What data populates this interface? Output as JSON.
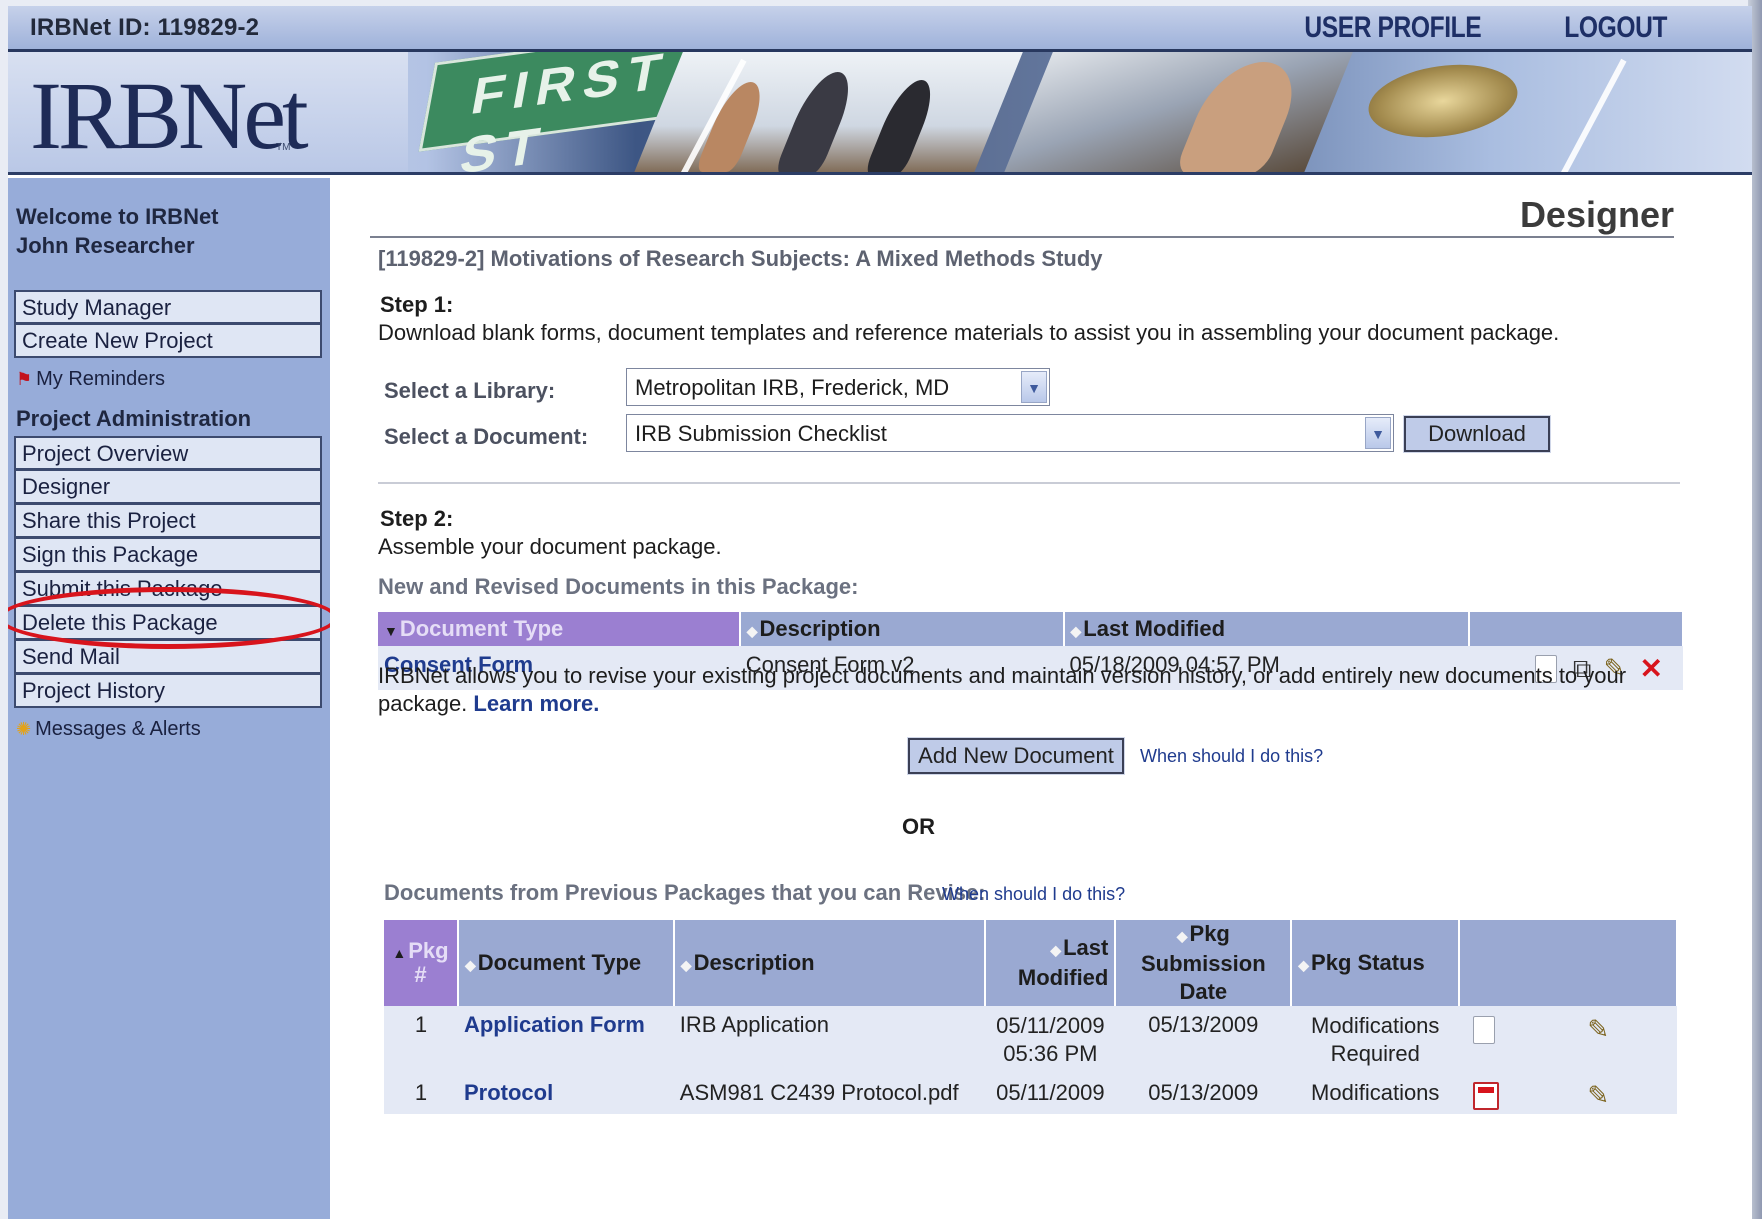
{
  "topbar": {
    "irb_id": "IRBNet ID: 119829-2",
    "user_profile": "USER PROFILE",
    "logout": "LOGOUT"
  },
  "banner": {
    "logo_text": "IRBNet",
    "tm": "TM",
    "street_sign": "FIRST ST"
  },
  "sidebar": {
    "welcome_line1": "Welcome to IRBNet",
    "welcome_line2": "John Researcher",
    "main_items": [
      "Study Manager",
      "Create New Project"
    ],
    "reminders": "My Reminders",
    "section_title": "Project Administration",
    "admin_items": [
      "Project Overview",
      "Designer",
      "Share this Project",
      "Sign this Package",
      "Submit this Package",
      "Delete this Package",
      "Send Mail",
      "Project History"
    ],
    "messages": "Messages & Alerts"
  },
  "main": {
    "page_title": "Designer",
    "project_title": "[119829-2] Motivations of Research Subjects: A Mixed Methods Study",
    "step1_label": "Step 1:",
    "step1_desc": "Download blank forms, document templates and reference materials to assist you in assembling your document package.",
    "library_label": "Select a Library:",
    "library_value": "Metropolitan IRB, Frederick, MD",
    "document_label": "Select a Document:",
    "document_value": "IRB Submission Checklist",
    "download_button": "Download",
    "step2_label": "Step 2:",
    "step2_desc": "Assemble your document package.",
    "new_docs_heading": "New and Revised Documents in this Package:",
    "new_docs_table": {
      "headers": [
        "Document Type",
        "Description",
        "Last Modified"
      ],
      "rows": [
        {
          "type": "Consent Form",
          "description": "Consent Form v2",
          "modified": "05/18/2009 04:57 PM"
        }
      ]
    },
    "info_text": "IRBNet allows you to revise your existing project documents and maintain version history, or add entirely new documents to your package.",
    "learn_more": "Learn more.",
    "add_button": "Add New Document",
    "when_link": "When should I do this?",
    "or_text": "OR",
    "prev_docs_heading": "Documents from Previous Packages that you can Revise:",
    "prev_when_link": "When should I do this?",
    "prev_table": {
      "headers": [
        "Pkg #",
        "Document Type",
        "Description",
        "Last Modified",
        "Pkg Submission Date",
        "Pkg Status"
      ],
      "rows": [
        {
          "pkg": "1",
          "type": "Application Form",
          "description": "IRB Application",
          "modified_date": "05/11/2009",
          "modified_time": "05:36 PM",
          "submitted": "05/13/2009",
          "status_line1": "Modifications",
          "status_line2": "Required",
          "icon": "document-icon"
        },
        {
          "pkg": "1",
          "type": "Protocol",
          "description": "ASM981 C2439 Protocol.pdf",
          "modified_date": "05/11/2009",
          "modified_time": "",
          "submitted": "05/13/2009",
          "status_line1": "Modifications",
          "status_line2": "",
          "icon": "pdf-icon"
        }
      ]
    }
  },
  "colors": {
    "sidebar": "#97acd9",
    "header_row": "#9aa9d2",
    "active_header": "#9b7fd1",
    "highlight_ellipse": "#d8141c",
    "link": "#1f3b8e"
  }
}
